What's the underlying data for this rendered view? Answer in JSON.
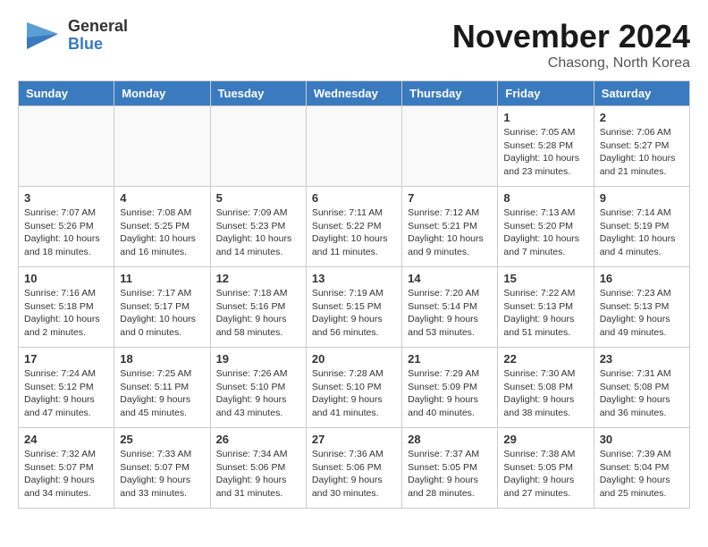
{
  "header": {
    "logo": {
      "line1": "General",
      "line2": "Blue"
    },
    "title": "November 2024",
    "location": "Chasong, North Korea"
  },
  "weekdays": [
    "Sunday",
    "Monday",
    "Tuesday",
    "Wednesday",
    "Thursday",
    "Friday",
    "Saturday"
  ],
  "weeks": [
    [
      {
        "day": "",
        "info": ""
      },
      {
        "day": "",
        "info": ""
      },
      {
        "day": "",
        "info": ""
      },
      {
        "day": "",
        "info": ""
      },
      {
        "day": "",
        "info": ""
      },
      {
        "day": "1",
        "info": "Sunrise: 7:05 AM\nSunset: 5:28 PM\nDaylight: 10 hours\nand 23 minutes."
      },
      {
        "day": "2",
        "info": "Sunrise: 7:06 AM\nSunset: 5:27 PM\nDaylight: 10 hours\nand 21 minutes."
      }
    ],
    [
      {
        "day": "3",
        "info": "Sunrise: 7:07 AM\nSunset: 5:26 PM\nDaylight: 10 hours\nand 18 minutes."
      },
      {
        "day": "4",
        "info": "Sunrise: 7:08 AM\nSunset: 5:25 PM\nDaylight: 10 hours\nand 16 minutes."
      },
      {
        "day": "5",
        "info": "Sunrise: 7:09 AM\nSunset: 5:23 PM\nDaylight: 10 hours\nand 14 minutes."
      },
      {
        "day": "6",
        "info": "Sunrise: 7:11 AM\nSunset: 5:22 PM\nDaylight: 10 hours\nand 11 minutes."
      },
      {
        "day": "7",
        "info": "Sunrise: 7:12 AM\nSunset: 5:21 PM\nDaylight: 10 hours\nand 9 minutes."
      },
      {
        "day": "8",
        "info": "Sunrise: 7:13 AM\nSunset: 5:20 PM\nDaylight: 10 hours\nand 7 minutes."
      },
      {
        "day": "9",
        "info": "Sunrise: 7:14 AM\nSunset: 5:19 PM\nDaylight: 10 hours\nand 4 minutes."
      }
    ],
    [
      {
        "day": "10",
        "info": "Sunrise: 7:16 AM\nSunset: 5:18 PM\nDaylight: 10 hours\nand 2 minutes."
      },
      {
        "day": "11",
        "info": "Sunrise: 7:17 AM\nSunset: 5:17 PM\nDaylight: 10 hours\nand 0 minutes."
      },
      {
        "day": "12",
        "info": "Sunrise: 7:18 AM\nSunset: 5:16 PM\nDaylight: 9 hours\nand 58 minutes."
      },
      {
        "day": "13",
        "info": "Sunrise: 7:19 AM\nSunset: 5:15 PM\nDaylight: 9 hours\nand 56 minutes."
      },
      {
        "day": "14",
        "info": "Sunrise: 7:20 AM\nSunset: 5:14 PM\nDaylight: 9 hours\nand 53 minutes."
      },
      {
        "day": "15",
        "info": "Sunrise: 7:22 AM\nSunset: 5:13 PM\nDaylight: 9 hours\nand 51 minutes."
      },
      {
        "day": "16",
        "info": "Sunrise: 7:23 AM\nSunset: 5:13 PM\nDaylight: 9 hours\nand 49 minutes."
      }
    ],
    [
      {
        "day": "17",
        "info": "Sunrise: 7:24 AM\nSunset: 5:12 PM\nDaylight: 9 hours\nand 47 minutes."
      },
      {
        "day": "18",
        "info": "Sunrise: 7:25 AM\nSunset: 5:11 PM\nDaylight: 9 hours\nand 45 minutes."
      },
      {
        "day": "19",
        "info": "Sunrise: 7:26 AM\nSunset: 5:10 PM\nDaylight: 9 hours\nand 43 minutes."
      },
      {
        "day": "20",
        "info": "Sunrise: 7:28 AM\nSunset: 5:10 PM\nDaylight: 9 hours\nand 41 minutes."
      },
      {
        "day": "21",
        "info": "Sunrise: 7:29 AM\nSunset: 5:09 PM\nDaylight: 9 hours\nand 40 minutes."
      },
      {
        "day": "22",
        "info": "Sunrise: 7:30 AM\nSunset: 5:08 PM\nDaylight: 9 hours\nand 38 minutes."
      },
      {
        "day": "23",
        "info": "Sunrise: 7:31 AM\nSunset: 5:08 PM\nDaylight: 9 hours\nand 36 minutes."
      }
    ],
    [
      {
        "day": "24",
        "info": "Sunrise: 7:32 AM\nSunset: 5:07 PM\nDaylight: 9 hours\nand 34 minutes."
      },
      {
        "day": "25",
        "info": "Sunrise: 7:33 AM\nSunset: 5:07 PM\nDaylight: 9 hours\nand 33 minutes."
      },
      {
        "day": "26",
        "info": "Sunrise: 7:34 AM\nSunset: 5:06 PM\nDaylight: 9 hours\nand 31 minutes."
      },
      {
        "day": "27",
        "info": "Sunrise: 7:36 AM\nSunset: 5:06 PM\nDaylight: 9 hours\nand 30 minutes."
      },
      {
        "day": "28",
        "info": "Sunrise: 7:37 AM\nSunset: 5:05 PM\nDaylight: 9 hours\nand 28 minutes."
      },
      {
        "day": "29",
        "info": "Sunrise: 7:38 AM\nSunset: 5:05 PM\nDaylight: 9 hours\nand 27 minutes."
      },
      {
        "day": "30",
        "info": "Sunrise: 7:39 AM\nSunset: 5:04 PM\nDaylight: 9 hours\nand 25 minutes."
      }
    ]
  ]
}
